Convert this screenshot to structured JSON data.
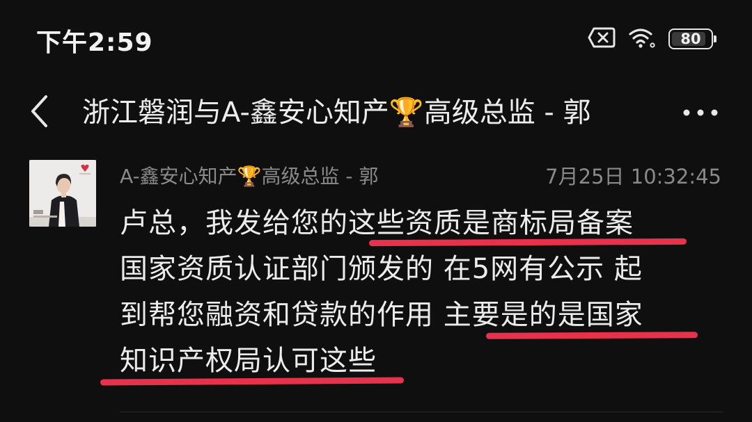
{
  "status_bar": {
    "time": "下午2:59",
    "icons": [
      "sim-off-icon",
      "wifi-icon",
      "battery-icon"
    ],
    "battery_level": "80"
  },
  "header": {
    "back_icon": "chevron-left-icon",
    "title": "浙江磐润与A-鑫安心知产🏆高级总监 - 郭",
    "more_icon": "more-horizontal-icon"
  },
  "message": {
    "sender": "A-鑫安心知产🏆高级总监 - 郭",
    "timestamp": "7月25日 10:32:45",
    "lines": [
      "卢总，我发给您的这些资质是商标局备案",
      "国家资质认证部门颁发的  在5网有公示  起",
      "到帮您融资和贷款的作用  主要是的是国家",
      "知识产权局认可这些"
    ],
    "highlight_color": "#e8314a"
  }
}
